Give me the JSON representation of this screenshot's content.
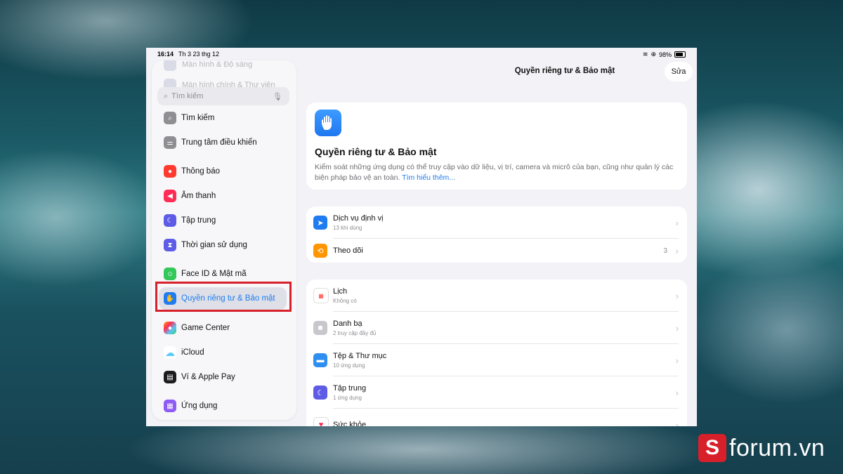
{
  "statusbar": {
    "time": "16:14",
    "date": "Th 3 23 thg 12",
    "battery": "98%"
  },
  "sidebar": {
    "ghost_items": [
      "Màn hình & Độ sáng",
      "Màn hình chính & Thư viện"
    ],
    "search_placeholder": "Tìm kiếm",
    "items": [
      {
        "label": "Tìm kiếm",
        "icon": "search-icon",
        "color": "#8e8e93"
      },
      {
        "label": "Trung tâm điều khiển",
        "icon": "toggles-icon",
        "color": "#8e8e93"
      },
      {
        "label": "Thông báo",
        "icon": "bell-icon",
        "color": "#ff3b30"
      },
      {
        "label": "Âm thanh",
        "icon": "speaker-icon",
        "color": "#ff2d55"
      },
      {
        "label": "Tập trung",
        "icon": "moon-icon",
        "color": "#5e5ce6"
      },
      {
        "label": "Thời gian sử dụng",
        "icon": "hourglass-icon",
        "color": "#5e5ce6"
      },
      {
        "label": "Face ID & Mật mã",
        "icon": "faceid-icon",
        "color": "#34c759"
      },
      {
        "label": "Quyền riêng tư & Bảo mật",
        "icon": "hand-icon",
        "color": "#1f7cf0"
      },
      {
        "label": "Game Center",
        "icon": "gamecenter-icon",
        "color": "#ff9f0a"
      },
      {
        "label": "iCloud",
        "icon": "cloud-icon",
        "color": "#5ac8fa"
      },
      {
        "label": "Ví & Apple Pay",
        "icon": "wallet-icon",
        "color": "#1c1c1e"
      },
      {
        "label": "Ứng dụng",
        "icon": "apps-icon",
        "color": "#8e5bf5"
      }
    ]
  },
  "main": {
    "title": "Quyền riêng tư & Bảo mật",
    "edit_label": "Sửa",
    "hero": {
      "title": "Quyền riêng tư & Bảo mật",
      "desc": "Kiểm soát những ứng dụng có thể truy cập vào dữ liệu, vị trí, camera và micrô của bạn, cũng như quản lý các biện pháp bảo vệ an toàn.",
      "link": "Tìm hiểu thêm..."
    },
    "group1": [
      {
        "label": "Dịch vụ định vị",
        "sub": "13 khi dùng",
        "icon": "location-icon",
        "color": "#1f7cf0",
        "value": ""
      },
      {
        "label": "Theo dõi",
        "sub": "",
        "icon": "tracking-icon",
        "color": "#ff9500",
        "value": "3"
      }
    ],
    "group2": [
      {
        "label": "Lịch",
        "sub": "Không có",
        "icon": "calendar-icon",
        "color": "#ffffff"
      },
      {
        "label": "Danh bạ",
        "sub": "2 truy cập đầy đủ",
        "icon": "contacts-icon",
        "color": "#c7c7cc"
      },
      {
        "label": "Tệp & Thư mục",
        "sub": "10 ứng dụng",
        "icon": "folder-icon",
        "color": "#2f8ff0"
      },
      {
        "label": "Tập trung",
        "sub": "1 ứng dụng",
        "icon": "moon-icon",
        "color": "#5e5ce6"
      },
      {
        "label": "Sức khỏe",
        "sub": "",
        "icon": "heart-icon",
        "color": "#ffffff"
      }
    ]
  },
  "watermark": {
    "letter": "S",
    "text": "forum.vn"
  }
}
